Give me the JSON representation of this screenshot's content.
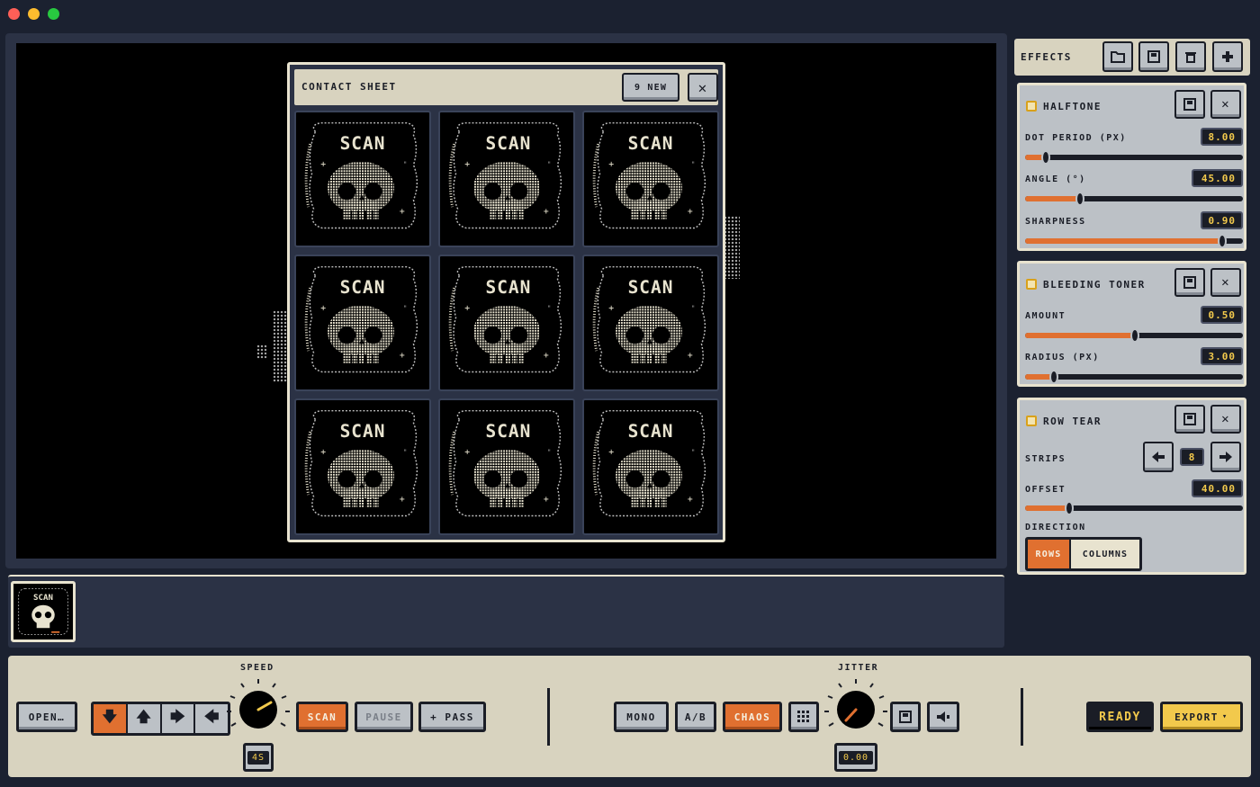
{
  "window": {
    "controls": [
      "close",
      "minimize",
      "maximize"
    ]
  },
  "sheet": {
    "title": "CONTACT SHEET",
    "new_badge": "9 NEW",
    "close_glyph": "✕",
    "tiles": [
      "SCAN",
      "SCAN",
      "SCAN",
      "SCAN",
      "SCAN",
      "SCAN",
      "SCAN",
      "SCAN",
      "SCAN"
    ]
  },
  "timeline": {
    "thumb_label": "SCAN"
  },
  "effects": {
    "title": "EFFECTS",
    "header_icons": [
      "folder-icon",
      "save-icon",
      "trash-icon",
      "plus-icon"
    ],
    "cards": [
      {
        "name": "HALFTONE",
        "params": [
          {
            "label": "DOT PERIOD (PX)",
            "value": "8.00",
            "fill": 0.1
          },
          {
            "label": "ANGLE (°)",
            "value": "45.00",
            "fill": 0.25
          },
          {
            "label": "SHARPNESS",
            "value": "0.90",
            "fill": 0.9
          }
        ]
      },
      {
        "name": "BLEEDING TONER",
        "params": [
          {
            "label": "AMOUNT",
            "value": "0.50",
            "fill": 0.5
          },
          {
            "label": "RADIUS (PX)",
            "value": "3.00",
            "fill": 0.13
          }
        ]
      },
      {
        "name": "ROW TEAR",
        "strips_label": "STRIPS",
        "strips_value": "8",
        "offset_label": "OFFSET",
        "offset_value": "40.00",
        "offset_fill": 0.2,
        "direction_label": "DIRECTION",
        "direction_options": [
          "ROWS",
          "COLUMNS"
        ],
        "direction_selected": "ROWS"
      }
    ]
  },
  "toolbar": {
    "open_label": "OPEN…",
    "speed_label": "SPEED",
    "speed_value": "4S",
    "scan_label": "SCAN",
    "pause_label": "PAUSE",
    "pass_label": "+ PASS",
    "mono_label": "MONO",
    "ab_label": "A/B",
    "chaos_label": "CHAOS",
    "jitter_label": "JITTER",
    "jitter_value": "0.00",
    "ready_label": "READY",
    "export_label": "EXPORT"
  },
  "colors": {
    "accent": "#e07030",
    "panel": "#d8d3bf",
    "bg": "#1b2130",
    "value_text": "#f2c94c"
  }
}
